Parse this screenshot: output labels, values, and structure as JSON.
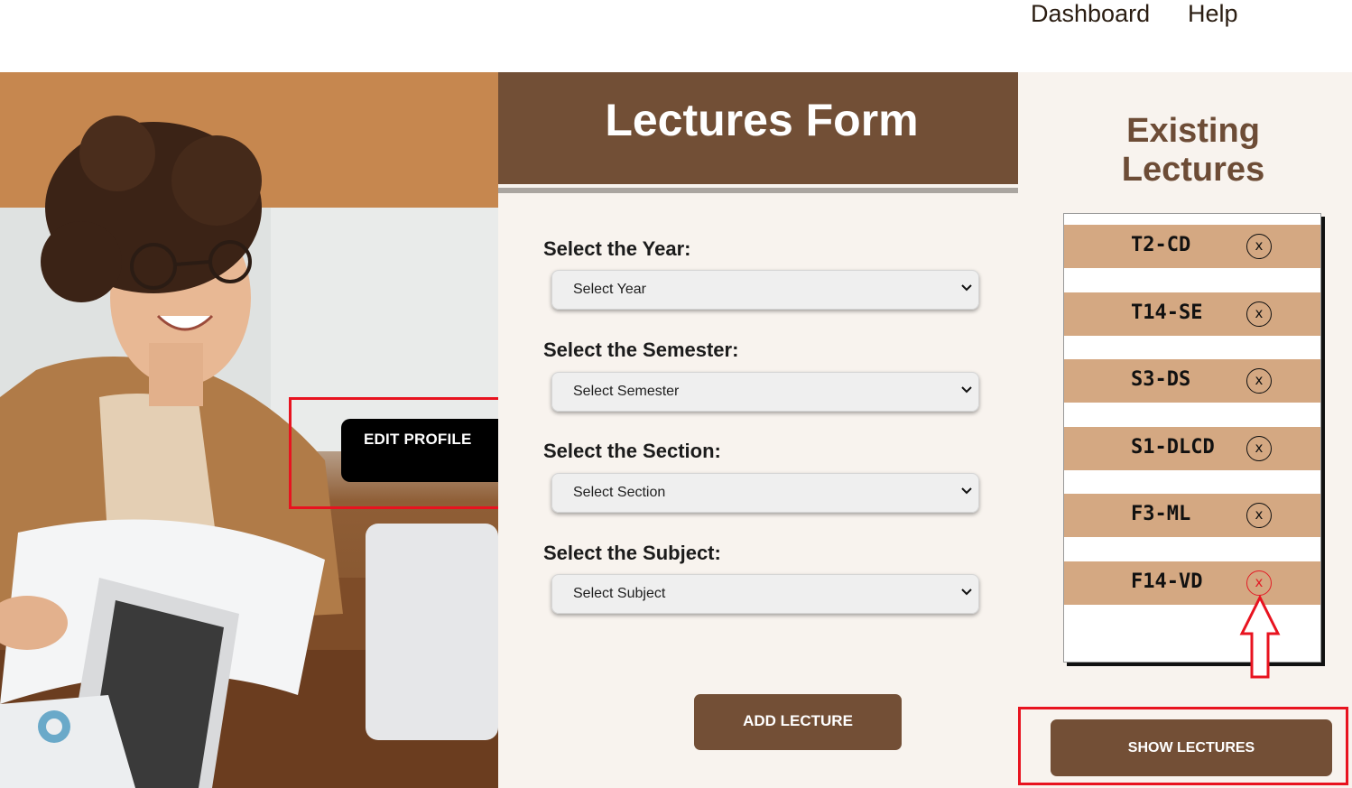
{
  "nav": {
    "dashboard": "Dashboard",
    "help": "Help"
  },
  "hero": {
    "edit_profile": "EDIT PROFILE"
  },
  "form": {
    "title": "Lectures Form",
    "fields": [
      {
        "label": "Select the Year:",
        "value": "Select Year"
      },
      {
        "label": "Select the Semester:",
        "value": "Select Semester"
      },
      {
        "label": "Select the Section:",
        "value": "Select Section"
      },
      {
        "label": "Select the Subject:",
        "value": "Select Subject"
      }
    ],
    "add_button": "ADD LECTURE"
  },
  "existing": {
    "title": "Existing Lectures",
    "lectures": [
      {
        "name": "T2-CD",
        "remove": "x"
      },
      {
        "name": "T14-SE",
        "remove": "x"
      },
      {
        "name": "S3-DS",
        "remove": "x"
      },
      {
        "name": "S1-DLCD",
        "remove": "x"
      },
      {
        "name": "F3-ML",
        "remove": "x"
      },
      {
        "name": "F14-VD",
        "remove": "x"
      }
    ],
    "show_button": "SHOW LECTURES"
  },
  "colors": {
    "brand_brown": "#734f36",
    "row_tan": "#d4a882",
    "panel_bg": "#f8f3ee",
    "annotation_red": "#e8131f"
  }
}
